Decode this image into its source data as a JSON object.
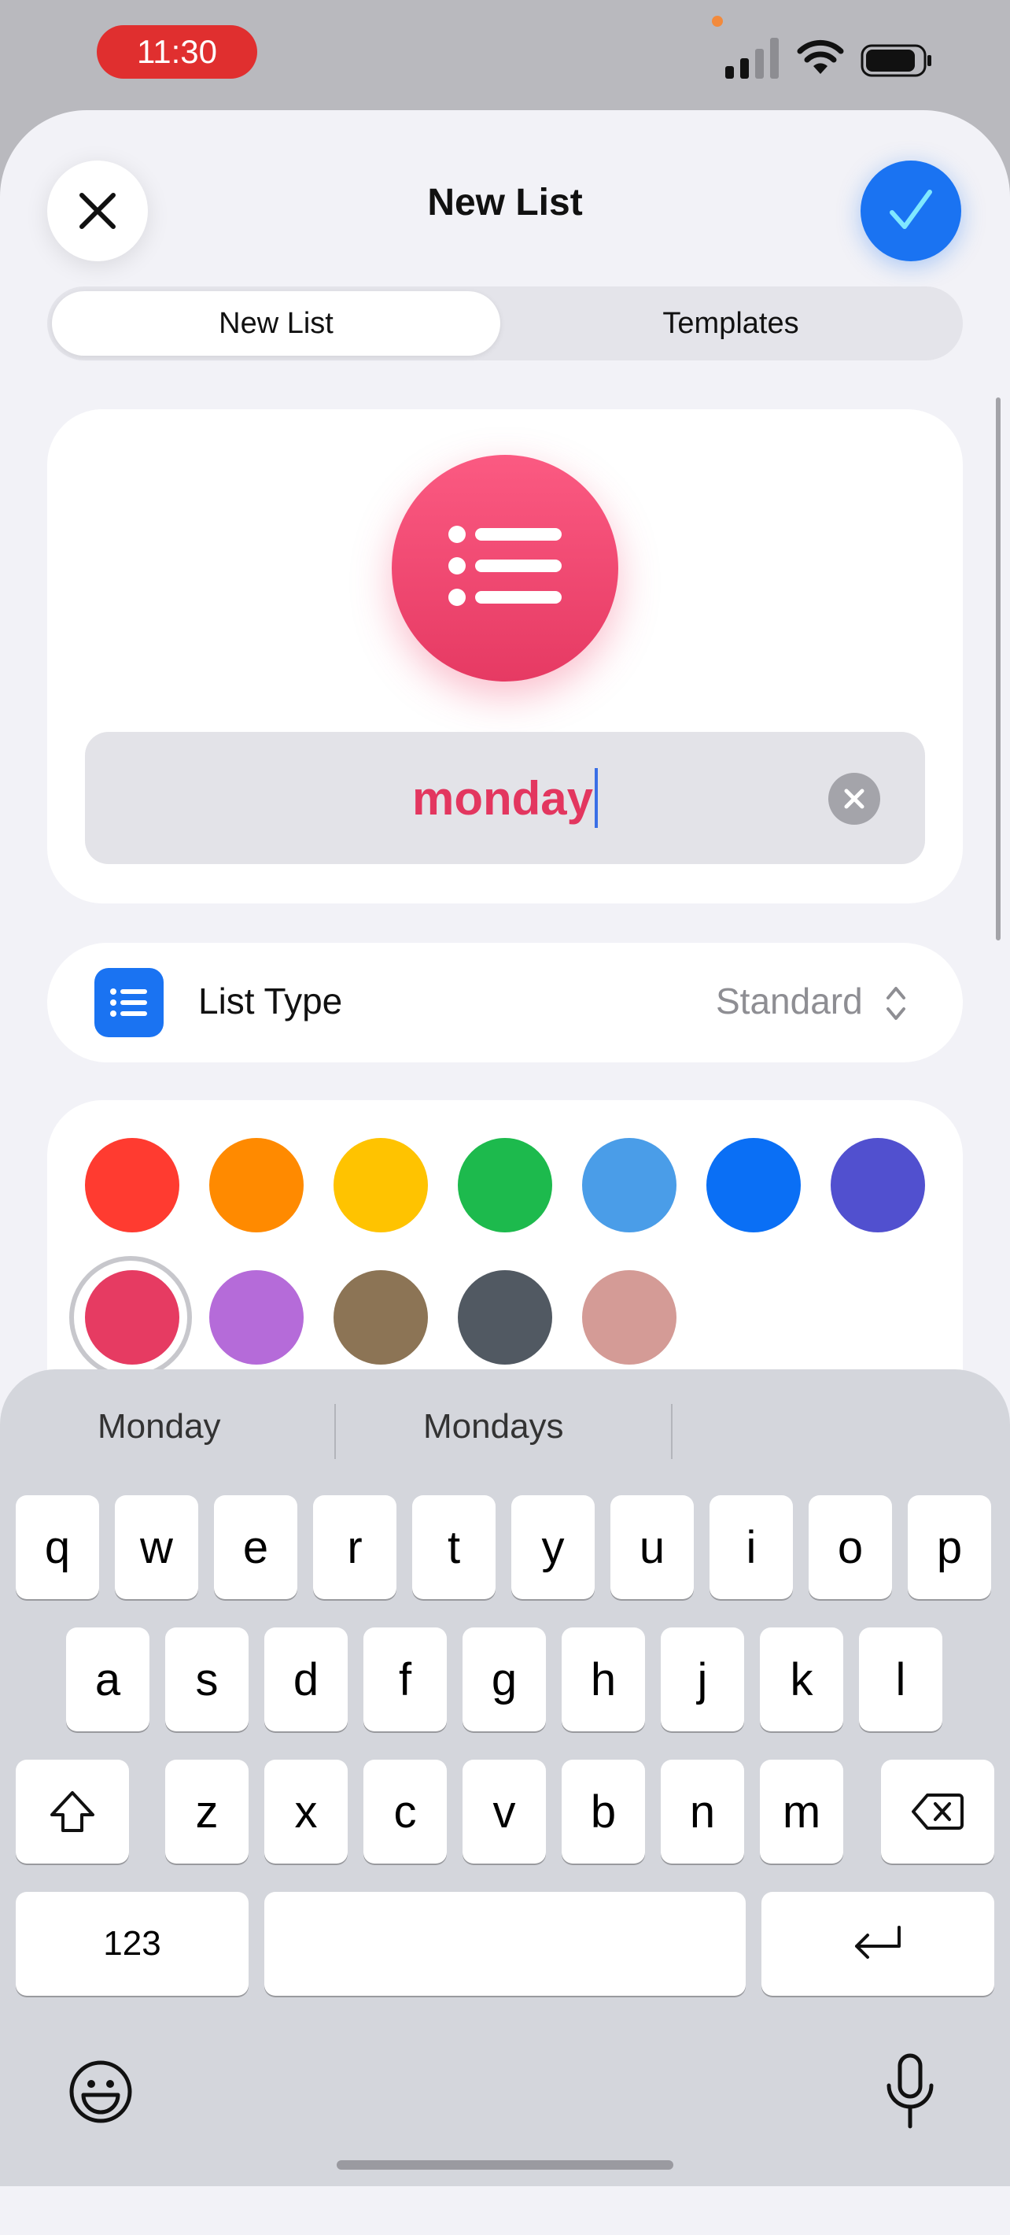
{
  "status_bar": {
    "time": "11:30"
  },
  "header": {
    "title": "New List",
    "close_icon": "close-icon",
    "done_icon": "checkmark-icon"
  },
  "segmented": {
    "tabs": [
      "New List",
      "Templates"
    ],
    "selected": "New List"
  },
  "list_name": {
    "value": "monday"
  },
  "list_type": {
    "label": "List Type",
    "value": "Standard"
  },
  "colors": {
    "swatches": [
      "#ff3b30",
      "#ff8a00",
      "#ffc300",
      "#1dba4d",
      "#4a9de8",
      "#0a6ff5",
      "#5150cf",
      "#e63b62",
      "#b56bd9",
      "#8c7455",
      "#515962",
      "#d49b96"
    ],
    "selected": "#e63b62"
  },
  "keyboard": {
    "suggestions": [
      "Monday",
      "Mondays",
      ""
    ],
    "row1": [
      "q",
      "w",
      "e",
      "r",
      "t",
      "y",
      "u",
      "i",
      "o",
      "p"
    ],
    "row2": [
      "a",
      "s",
      "d",
      "f",
      "g",
      "h",
      "j",
      "k",
      "l"
    ],
    "row3": [
      "z",
      "x",
      "c",
      "v",
      "b",
      "n",
      "m"
    ],
    "numbers_key": "123"
  },
  "accent_colors": {
    "pink": "#e3365f",
    "blue": "#1a73f2"
  }
}
